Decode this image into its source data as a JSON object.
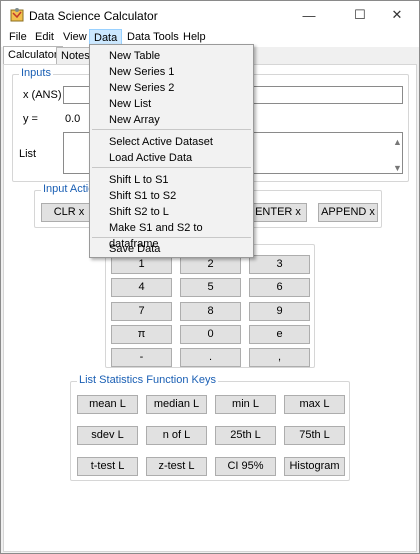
{
  "window": {
    "title": "Data Science Calculator",
    "minimize": "—",
    "maximize": "☐",
    "close": "✕"
  },
  "menubar": [
    "File",
    "Edit",
    "View",
    "Data",
    "Data Tools",
    "Help"
  ],
  "tabs": [
    "Calculator",
    "Notes"
  ],
  "inputs": {
    "legend": "Inputs",
    "x_label": "x (ANS)",
    "y_label": "y  =",
    "y_value": "0.0",
    "list_label": "List"
  },
  "input_actions": {
    "legend": "Input Actio",
    "clr": "CLR x",
    "enter": "ENTER x",
    "append": "APPEND x"
  },
  "keypad": [
    "1",
    "2",
    "3",
    "4",
    "5",
    "6",
    "7",
    "8",
    "9",
    "π",
    "0",
    "e",
    "-",
    ".",
    ","
  ],
  "list_stats": {
    "legend": "List Statistics Function Keys",
    "keys": [
      "mean L",
      "median L",
      "min L",
      "max L",
      "sdev L",
      "n of L",
      "25th L",
      "75th L",
      "t-test L",
      "z-test L",
      "CI 95%",
      "Histogram"
    ]
  },
  "data_menu": {
    "groups": [
      [
        "New Table",
        "New Series 1",
        "New Series 2",
        "New List",
        "New Array"
      ],
      [
        "Select Active Dataset",
        "Load Active Data"
      ],
      [
        "Shift L to S1",
        "Shift S1 to S2",
        "Shift S2 to L",
        "Make S1 and S2 to dataframe"
      ],
      [
        "Save Data"
      ]
    ]
  }
}
